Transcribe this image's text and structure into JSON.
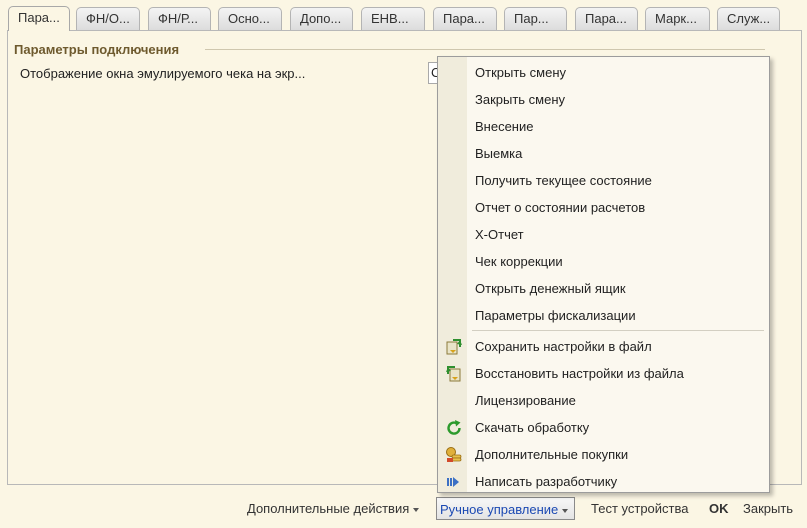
{
  "tabs": [
    {
      "label": "Пара...",
      "active": true
    },
    {
      "label": "ФН/О..."
    },
    {
      "label": "ФН/Р..."
    },
    {
      "label": "Осно..."
    },
    {
      "label": "Допо..."
    },
    {
      "label": "ЕНВ..."
    },
    {
      "label": "Пара..."
    },
    {
      "label": "Пар..."
    },
    {
      "label": "Пара..."
    },
    {
      "label": "Марк..."
    },
    {
      "label": "Служ..."
    }
  ],
  "section": {
    "title": "Параметры подключения",
    "field_label": "Отображение окна эмулируемого чека на экр...",
    "field_value": "С"
  },
  "menu": {
    "items": [
      {
        "label": "Открыть смену",
        "icon": ""
      },
      {
        "label": "Закрыть смену",
        "icon": ""
      },
      {
        "label": "Внесение",
        "icon": ""
      },
      {
        "label": "Выемка",
        "icon": ""
      },
      {
        "label": "Получить текущее состояние",
        "icon": ""
      },
      {
        "label": "Отчет о состоянии расчетов",
        "icon": ""
      },
      {
        "label": "X-Отчет",
        "icon": ""
      },
      {
        "label": "Чек коррекции",
        "icon": ""
      },
      {
        "label": "Открыть денежный ящик",
        "icon": ""
      },
      {
        "label": "Параметры фискализации",
        "icon": ""
      },
      {
        "label": "Сохранить настройки в файл",
        "icon": "save-settings-icon"
      },
      {
        "label": "Восстановить настройки из файла",
        "icon": "restore-settings-icon"
      },
      {
        "label": "Лицензирование",
        "icon": ""
      },
      {
        "label": "Скачать обработку",
        "icon": "refresh-icon"
      },
      {
        "label": "Дополнительные покупки",
        "icon": "coins-icon"
      },
      {
        "label": "Написать разработчику",
        "icon": "arrow-right-icon"
      }
    ]
  },
  "bottom": {
    "more_actions": "Дополнительные действия",
    "manual_control": "Ручное управление",
    "test_device": "Тест устройства",
    "ok": "OK",
    "close": "Закрыть"
  },
  "colors": {
    "background": "#fbf6e4",
    "group_title": "#6e5a2e",
    "active_link": "#1b49b3"
  }
}
